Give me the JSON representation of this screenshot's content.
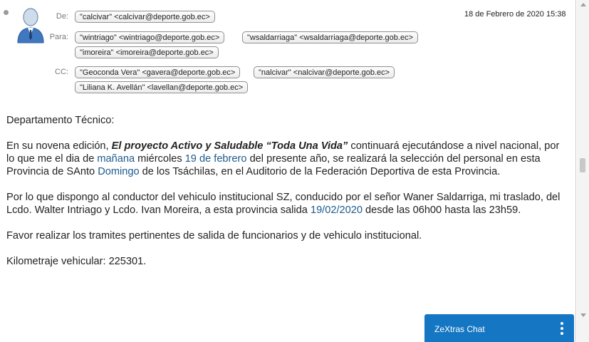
{
  "header": {
    "from_label": "De:",
    "to_label": "Para:",
    "cc_label": "CC:",
    "date": "18 de Febrero de 2020 15:38",
    "from": [
      "\"calcivar\" <calcivar@deporte.gob.ec>"
    ],
    "to": [
      "\"wintriago\" <wintriago@deporte.gob.ec>",
      "\"wsaldarriaga\" <wsaldarriaga@deporte.gob.ec>",
      "\"imoreira\" <imoreira@deporte.gob.ec>"
    ],
    "cc": [
      "\"Geoconda Vera\" <gavera@deporte.gob.ec>",
      "\"nalcivar\" <nalcivar@deporte.gob.ec>",
      "\"Liliana K. Avellán\" <lavellan@deporte.gob.ec>"
    ]
  },
  "body": {
    "greeting": "Departamento Técnico:",
    "p1": {
      "t1": "En su novena edición, ",
      "project": "El proyecto Activo y Saludable “Toda Una Vida”",
      "t2": " continuará ejecutándose a nivel nacional, por lo que me el dia de ",
      "link1": "mañana",
      "t3": " miércoles ",
      "link2": "19 de febrero",
      "t4": " del presente año, se realizará  la selección del personal  en esta Provincia de SAnto ",
      "link3": "Domingo",
      "t5": " de los Tsáchilas, en el Auditorio de la Federación Deportiva de esta Provincia."
    },
    "p2": {
      "t1": "Por lo que dispongo al conductor del vehiculo institucional SZ, conducido por el señor Waner Saldarriga, mi traslado, del Lcdo. Walter Intriago y Lcdo. Ivan Moreira, a esta provincia salida ",
      "link1": "19/02/2020",
      "t2": " desde las 06h00 hasta las 23h59."
    },
    "p3": "Favor realizar los tramites pertinentes de salida de funcionarios y de vehiculo institucional.",
    "p4": "Kilometraje vehicular: 225301."
  },
  "chat": {
    "title": "ZeXtras Chat"
  },
  "colors": {
    "link": "#1c5a8c",
    "chat_bar": "#1577c4"
  }
}
